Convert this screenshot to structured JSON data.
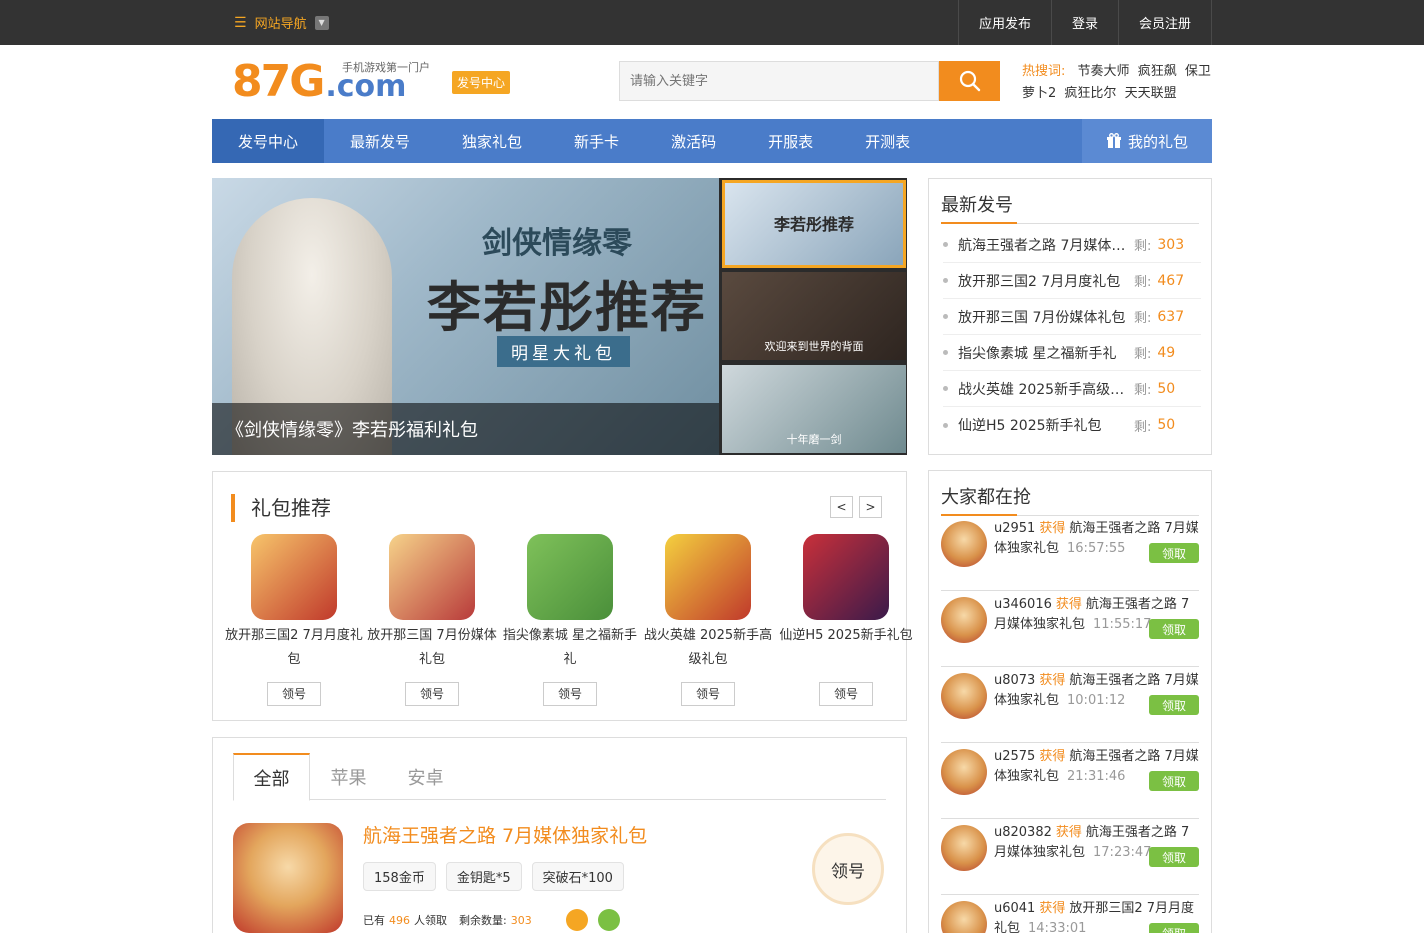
{
  "topbar": {
    "site_nav": "网站导航",
    "links": [
      "应用发布",
      "登录",
      "会员注册"
    ]
  },
  "header": {
    "logo_num": "87G",
    "logo_com": ".com",
    "logo_tag": "手机游戏第一门户",
    "badge": "发号中心",
    "search_placeholder": "请输入关键字",
    "hot_label": "热搜词:",
    "hot_words": [
      "节奏大师",
      "疯狂飙",
      "保卫萝卜2",
      "疯狂比尔",
      "天天联盟"
    ]
  },
  "nav": {
    "items": [
      "发号中心",
      "最新发号",
      "独家礼包",
      "新手卡",
      "激活码",
      "开服表",
      "开测表"
    ],
    "my_gift": "我的礼包"
  },
  "banner": {
    "title1": "剑侠情缘零",
    "title2": "李若彤推荐",
    "title3": "明星大礼包",
    "caption": "《剑侠情缘零》李若彤福利礼包",
    "thumbs": [
      "李若彤推荐",
      "欢迎来到世界的背面",
      "十年磨一剑"
    ]
  },
  "recommend": {
    "title": "礼包推荐",
    "prev": "<",
    "next": ">",
    "gifts": [
      {
        "name": "放开那三国2 7月月度礼包",
        "btn": "领号"
      },
      {
        "name": "放开那三国 7月份媒体礼包",
        "btn": "领号"
      },
      {
        "name": "指尖像素城 星之福新手礼",
        "btn": "领号"
      },
      {
        "name": "战火英雄 2025新手高级礼包",
        "btn": "领号"
      },
      {
        "name": "仙逆H5 2025新手礼包",
        "btn": "领号"
      }
    ]
  },
  "list": {
    "tabs": [
      "全部",
      "苹果",
      "安卓"
    ],
    "item": {
      "title": "航海王强者之路 7月媒体独家礼包",
      "tags": [
        "158金币",
        "金钥匙*5",
        "突破石*100"
      ],
      "meta_pre": "已有",
      "meta_count": "496",
      "meta_mid": "人领取",
      "meta_left_label": "剩余数量:",
      "meta_left": "303",
      "btn": "领号"
    }
  },
  "latest": {
    "title": "最新发号",
    "left_label": "剩:",
    "items": [
      {
        "name": "航海王强者之路 7月媒体独家礼包",
        "count": "303"
      },
      {
        "name": "放开那三国2 7月月度礼包",
        "count": "467"
      },
      {
        "name": "放开那三国 7月份媒体礼包",
        "count": "637"
      },
      {
        "name": "指尖像素城 星之福新手礼",
        "count": "49"
      },
      {
        "name": "战火英雄 2025新手高级礼包",
        "count": "50"
      },
      {
        "name": "仙逆H5 2025新手礼包",
        "count": "50"
      }
    ]
  },
  "grab": {
    "title": "大家都在抢",
    "action": "获得",
    "btn": "领取",
    "rows": [
      {
        "user": "u2951",
        "gift": "航海王强者之路 7月媒体独家礼包",
        "time": "16:57:55"
      },
      {
        "user": "u346016",
        "gift": "航海王强者之路 7月媒体独家礼包",
        "time": "11:55:17"
      },
      {
        "user": "u8073",
        "gift": "航海王强者之路 7月媒体独家礼包",
        "time": "10:01:12"
      },
      {
        "user": "u2575",
        "gift": "航海王强者之路 7月媒体独家礼包",
        "time": "21:31:46"
      },
      {
        "user": "u820382",
        "gift": "航海王强者之路 7月媒体独家礼包",
        "time": "17:23:47"
      },
      {
        "user": "u6041",
        "gift": "放开那三国2 7月月度礼包",
        "time": "14:33:01"
      }
    ]
  }
}
